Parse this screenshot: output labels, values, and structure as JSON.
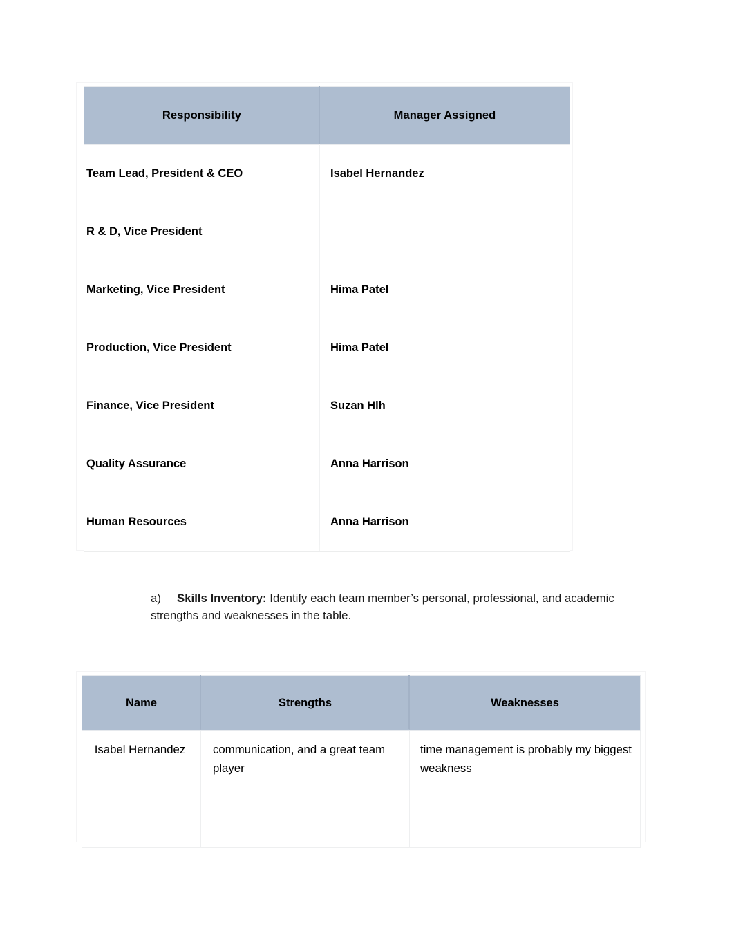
{
  "document": {
    "background_color": "#ffffff",
    "header_fill_color": "#aebdd0",
    "text_color": "#000000"
  },
  "responsibility_table": {
    "columns": [
      "Responsibility",
      "Manager Assigned"
    ],
    "rows": [
      {
        "responsibility": "Team Lead, President & CEO",
        "manager": "Isabel Hernandez"
      },
      {
        "responsibility": "R & D, Vice President",
        "manager": ""
      },
      {
        "responsibility": "Marketing, Vice President",
        "manager": "Hima Patel"
      },
      {
        "responsibility": "Production, Vice President",
        "manager": "Hima Patel"
      },
      {
        "responsibility": "Finance, Vice President",
        "manager": "Suzan Hlh"
      },
      {
        "responsibility": "Quality Assurance",
        "manager": "Anna Harrison"
      },
      {
        "responsibility": "Human Resources",
        "manager": "Anna Harrison"
      }
    ]
  },
  "instruction_paragraph": {
    "marker": "a)",
    "lead": "Skills Inventory:",
    "body": " Identify each team member’s personal, professional, and academic strengths and weaknesses in the table."
  },
  "skills_table": {
    "columns": [
      "Name",
      "Strengths",
      "Weaknesses"
    ],
    "rows": [
      {
        "name": "Isabel Hernandez",
        "strengths": " communication, and a great team player",
        "weaknesses": " time management is probably my biggest weakness"
      }
    ]
  }
}
